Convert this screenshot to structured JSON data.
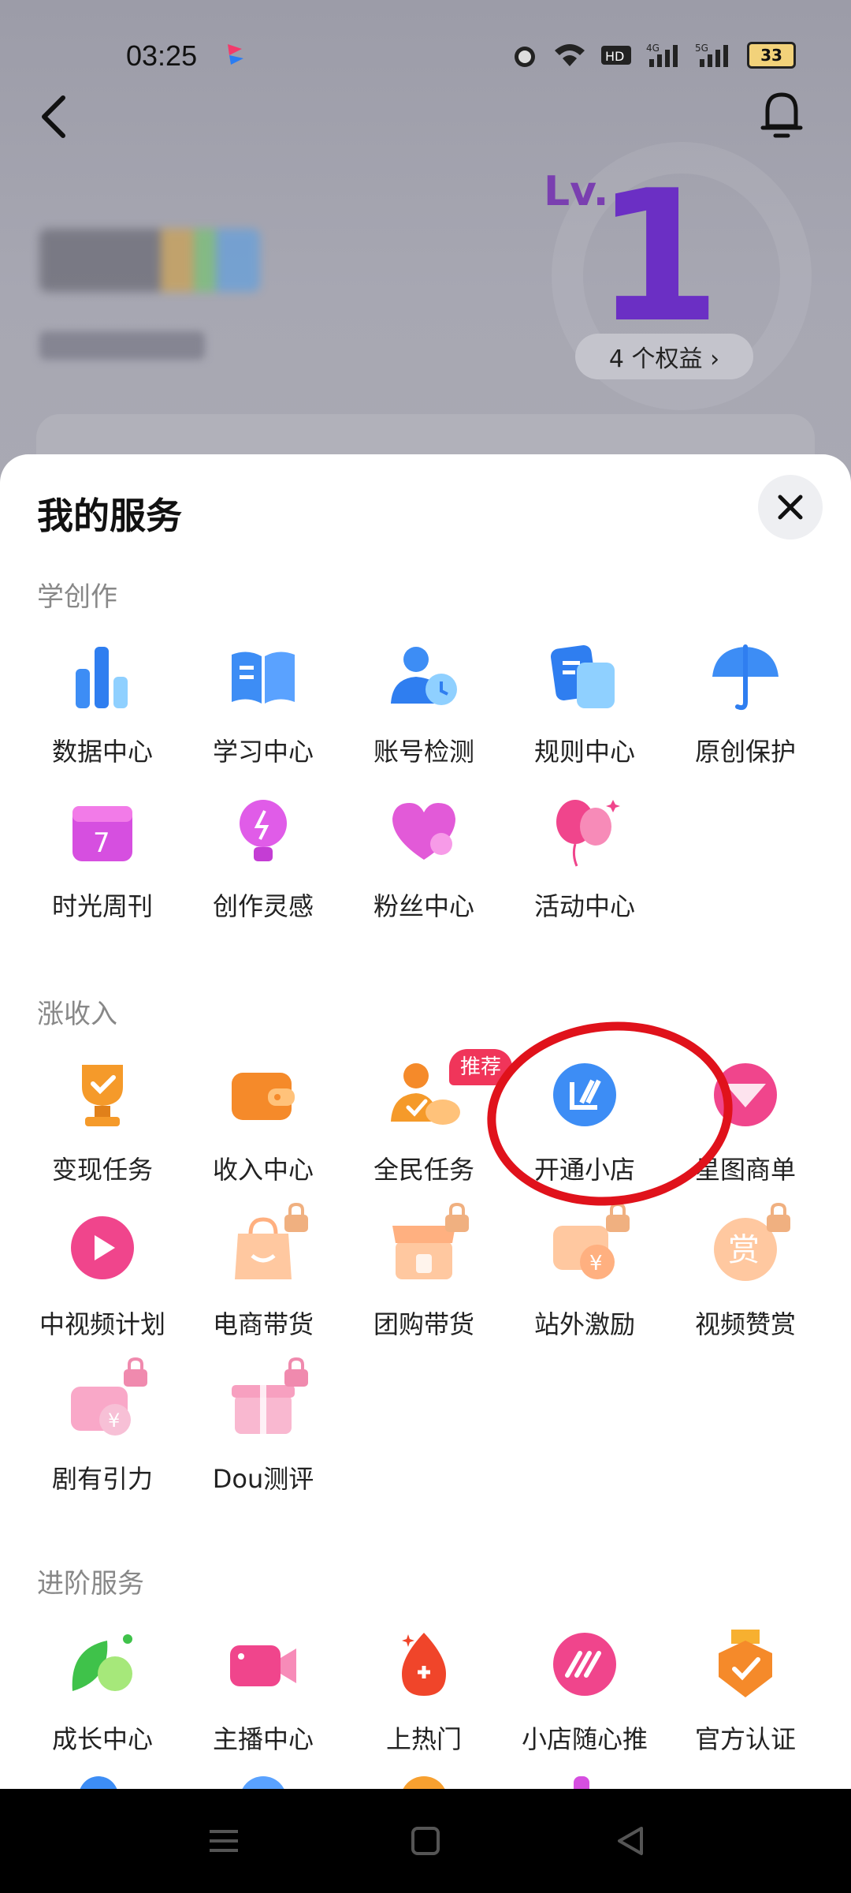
{
  "status_bar": {
    "time": "03:25",
    "battery": "33"
  },
  "header": {
    "level_text": "Lv.",
    "level_number": "1",
    "benefits_button": "4 个权益 ›"
  },
  "sheet": {
    "title": "我的服务",
    "sections": [
      {
        "title": "学创作",
        "items": [
          {
            "label": "数据中心",
            "icon": "bar-chart-icon"
          },
          {
            "label": "学习中心",
            "icon": "book-icon"
          },
          {
            "label": "账号检测",
            "icon": "account-check-icon"
          },
          {
            "label": "规则中心",
            "icon": "rules-doc-icon"
          },
          {
            "label": "原创保护",
            "icon": "umbrella-icon"
          },
          {
            "label": "时光周刊",
            "icon": "calendar-icon"
          },
          {
            "label": "创作灵感",
            "icon": "lightbulb-icon"
          },
          {
            "label": "粉丝中心",
            "icon": "heart-icon"
          },
          {
            "label": "活动中心",
            "icon": "balloons-icon"
          }
        ]
      },
      {
        "title": "涨收入",
        "items": [
          {
            "label": "变现任务",
            "icon": "trophy-icon"
          },
          {
            "label": "收入中心",
            "icon": "wallet-icon"
          },
          {
            "label": "全民任务",
            "icon": "people-task-icon",
            "tag": "推荐"
          },
          {
            "label": "开通小店",
            "icon": "shop-icon"
          },
          {
            "label": "星图商单",
            "icon": "star-chart-icon"
          },
          {
            "label": "中视频计划",
            "icon": "play-icon"
          },
          {
            "label": "电商带货",
            "icon": "shopping-bag-icon"
          },
          {
            "label": "团购带货",
            "icon": "store-icon"
          },
          {
            "label": "站外激励",
            "icon": "video-yuan-icon"
          },
          {
            "label": "视频赞赏",
            "icon": "reward-icon"
          },
          {
            "label": "剧有引力",
            "icon": "drama-icon"
          },
          {
            "label": "Dou测评",
            "icon": "gift-icon"
          }
        ]
      },
      {
        "title": "进阶服务",
        "items": [
          {
            "label": "成长中心",
            "icon": "leaf-icon"
          },
          {
            "label": "主播中心",
            "icon": "camera-icon"
          },
          {
            "label": "上热门",
            "icon": "flame-icon"
          },
          {
            "label": "小店随心推",
            "icon": "promote-icon"
          },
          {
            "label": "官方认证",
            "icon": "badge-icon"
          }
        ]
      }
    ]
  },
  "colors": {
    "highlight_circle": "#e0121b",
    "tag": "#f0355a"
  }
}
